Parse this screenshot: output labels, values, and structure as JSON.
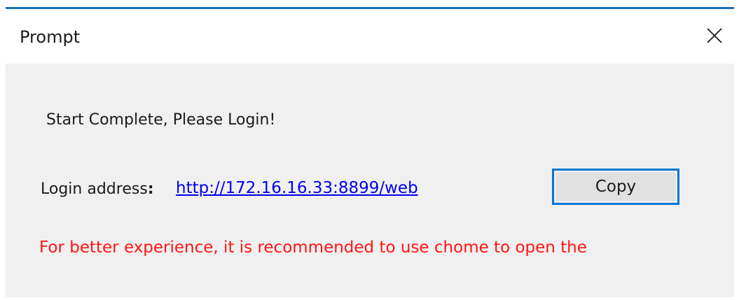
{
  "window": {
    "title": "Prompt",
    "accent_color": "#1a6fb5"
  },
  "close_icon": "close-icon",
  "message": "Start Complete, Please Login!",
  "login": {
    "label": "Login address",
    "colon": ":",
    "url": "http://172.16.16.33:8899/web",
    "link_color": "#0000ee"
  },
  "copy_button": {
    "label": "Copy",
    "border_color": "#0078d7"
  },
  "warning": {
    "text": "For better experience, it is recommended to use chome to open the",
    "color": "#ff1414"
  }
}
